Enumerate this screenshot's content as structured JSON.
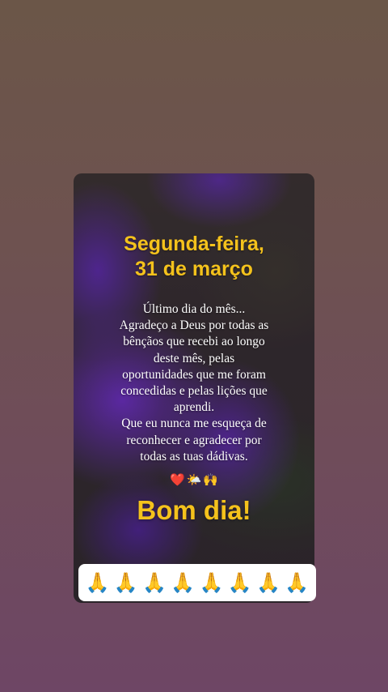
{
  "headline": {
    "line1": "Segunda-feira,",
    "line2": "31 de março"
  },
  "message": {
    "lines": [
      "Último dia do mês...",
      "Agradeço a Deus por todas as",
      "bênçãos que recebi ao longo",
      "deste mês, pelas",
      "oportunidades que me foram",
      "concedidas e pelas lições que",
      "aprendi.",
      "Que eu nunca me esqueça de",
      "reconhecer e agradecer por",
      "todas as tuas dádivas."
    ]
  },
  "emojis": {
    "heart": "❤️",
    "sun_cloud": "🌤️",
    "raised_hands": "🙌"
  },
  "greeting": "Bom dia!",
  "reactions": [
    "🙏",
    "🙏",
    "🙏",
    "🙏",
    "🙏",
    "🙏",
    "🙏",
    "🙏"
  ],
  "colors": {
    "headline": "#f4c21c",
    "message": "#ffffff",
    "reaction_bar": "#ffffff"
  }
}
